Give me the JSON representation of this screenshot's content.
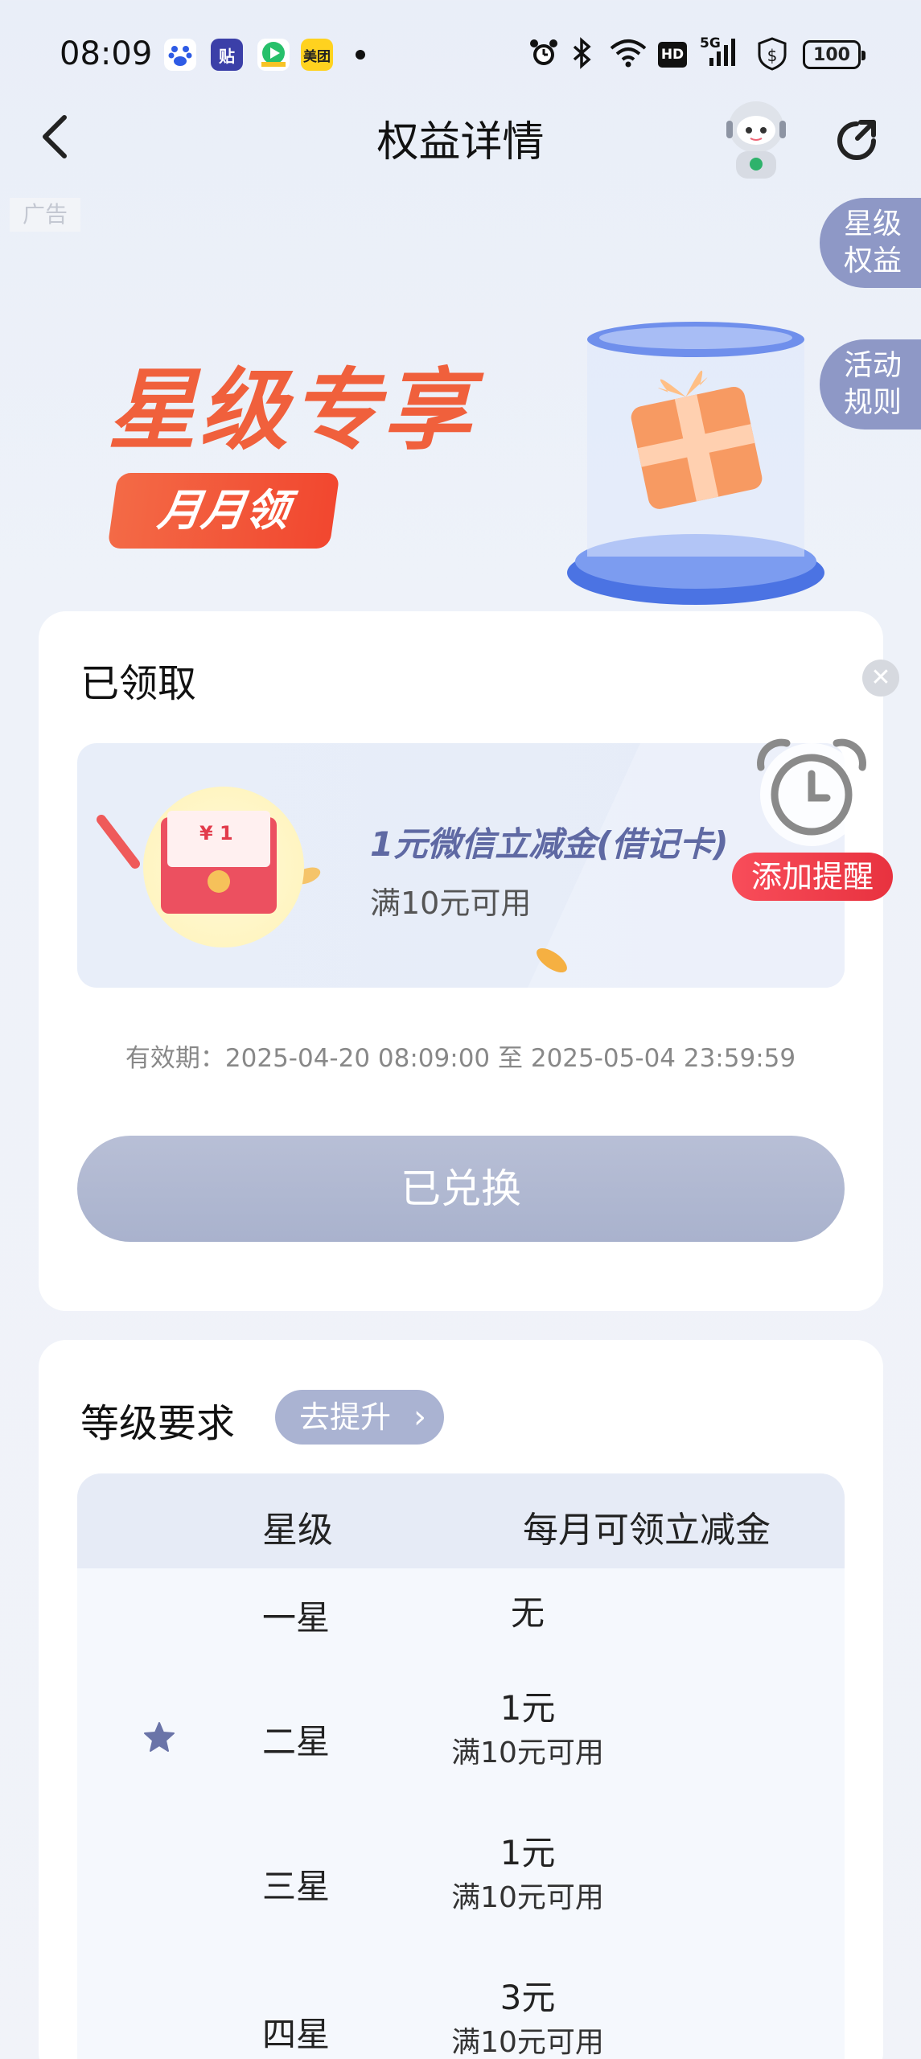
{
  "status_bar": {
    "time": "08:09",
    "apps": [
      "baidu-icon",
      "tieba-icon",
      "video-icon",
      "meituan-icon"
    ],
    "meituan_label": "美团",
    "tieba_label": "贴",
    "hd_label": "HD",
    "signal_label": "5G",
    "battery": "100"
  },
  "nav": {
    "title": "权益详情"
  },
  "ad_tag": "广告",
  "side_tabs": [
    {
      "line1": "星级",
      "line2": "权益"
    },
    {
      "line1": "活动",
      "line2": "规则"
    }
  ],
  "banner": {
    "title": "星级专享",
    "pill": "月月领"
  },
  "received": {
    "heading": "已领取",
    "coupon_title": "1元微信立减金(借记卡)",
    "coupon_sub": "满10元可用",
    "envelope_amount": "¥ 1",
    "remind_label": "添加提醒",
    "validity": "有效期：2025-04-20 08:09:00 至 2025-05-04 23:59:59",
    "redeem_label": "已兑换"
  },
  "requirements": {
    "heading": "等级要求",
    "upgrade_label": "去提升",
    "columns": [
      "星级",
      "每月可领立减金"
    ],
    "rows": [
      {
        "level": "一星",
        "value": "无",
        "sub": "",
        "current": false
      },
      {
        "level": "二星",
        "value": "1元",
        "sub": "满10元可用",
        "current": true
      },
      {
        "level": "三星",
        "value": "1元",
        "sub": "满10元可用",
        "current": false
      },
      {
        "level": "四星",
        "value": "3元",
        "sub": "满10元可用",
        "current": false
      }
    ]
  },
  "colors": {
    "accent": "#8e98c6",
    "banner_red": "#f0603c",
    "remind_red": "#f84d5a",
    "coupon_title": "#5f69a3"
  }
}
